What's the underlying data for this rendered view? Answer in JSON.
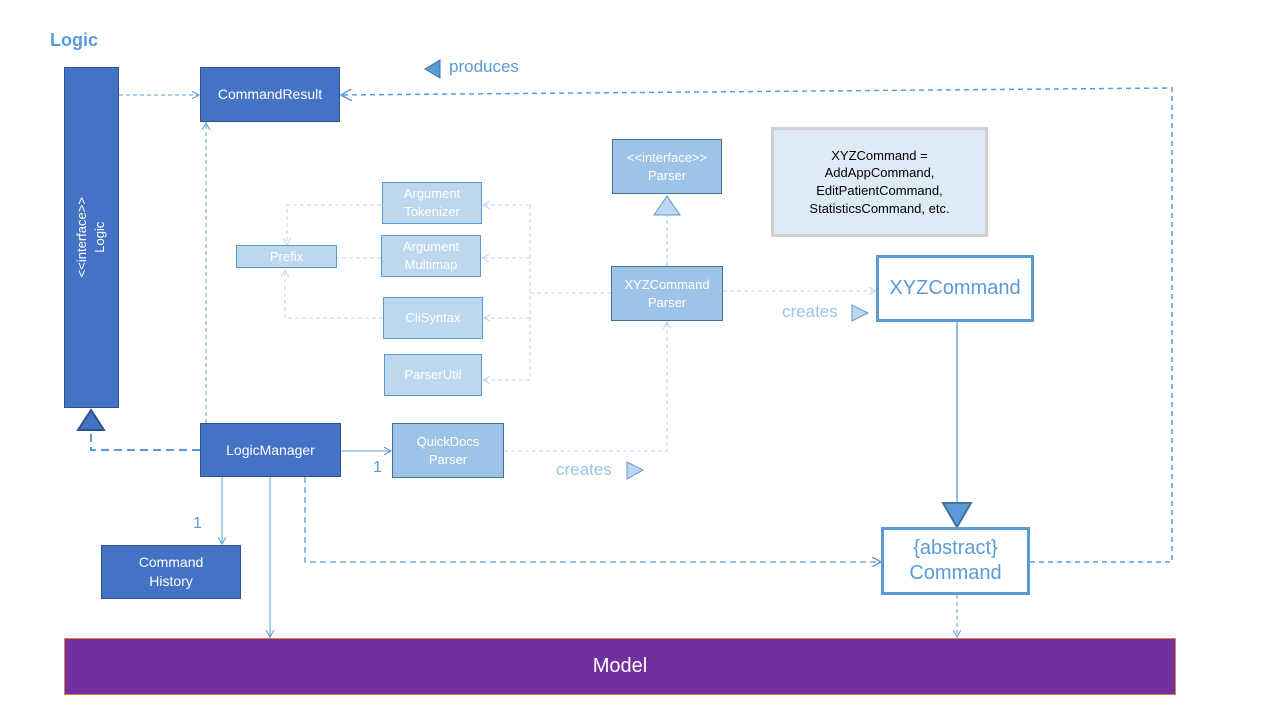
{
  "title": "Logic",
  "labels": {
    "produces": "produces",
    "creates_1": "creates",
    "creates_2": "creates",
    "multiplicity_history": "1",
    "multiplicity_parser": "1"
  },
  "boxes": {
    "logic_interface": {
      "stereotype": "<<interface>>",
      "name": "Logic"
    },
    "command_result": {
      "name": "CommandResult"
    },
    "parser_interface": {
      "stereotype": "<<interface>>",
      "name": "Parser"
    },
    "argument_tokenizer": {
      "line1": "Argument",
      "line2": "Tokenizer"
    },
    "argument_multimap": {
      "line1": "Argument",
      "line2": "Multimap"
    },
    "prefix": {
      "name": "Prefix"
    },
    "cli_syntax": {
      "name": "CliSyntax"
    },
    "parser_util": {
      "name": "ParserUtil"
    },
    "xyz_command_parser": {
      "line1": "XYZCommand",
      "line2": "Parser"
    },
    "xyz_command": {
      "name": "XYZCommand"
    },
    "logic_manager": {
      "name": "LogicManager"
    },
    "quickdocs_parser": {
      "line1": "QuickDocs",
      "line2": "Parser"
    },
    "command_history": {
      "line1": "Command",
      "line2": "History"
    },
    "abstract_command": {
      "line1": "{abstract}",
      "line2": "Command"
    },
    "model": {
      "name": "Model"
    }
  },
  "note": {
    "line1": "XYZCommand =",
    "line2": "AddAppCommand,",
    "line3": "EditPatientCommand,",
    "line4": "StatisticsCommand, etc."
  },
  "colors": {
    "dark_blue": "#4472c4",
    "light_blue": "#9dc3e6",
    "pale_blue": "#bdd7ee",
    "outline_blue": "#5b9bd5",
    "model_purple": "#7030a0"
  }
}
